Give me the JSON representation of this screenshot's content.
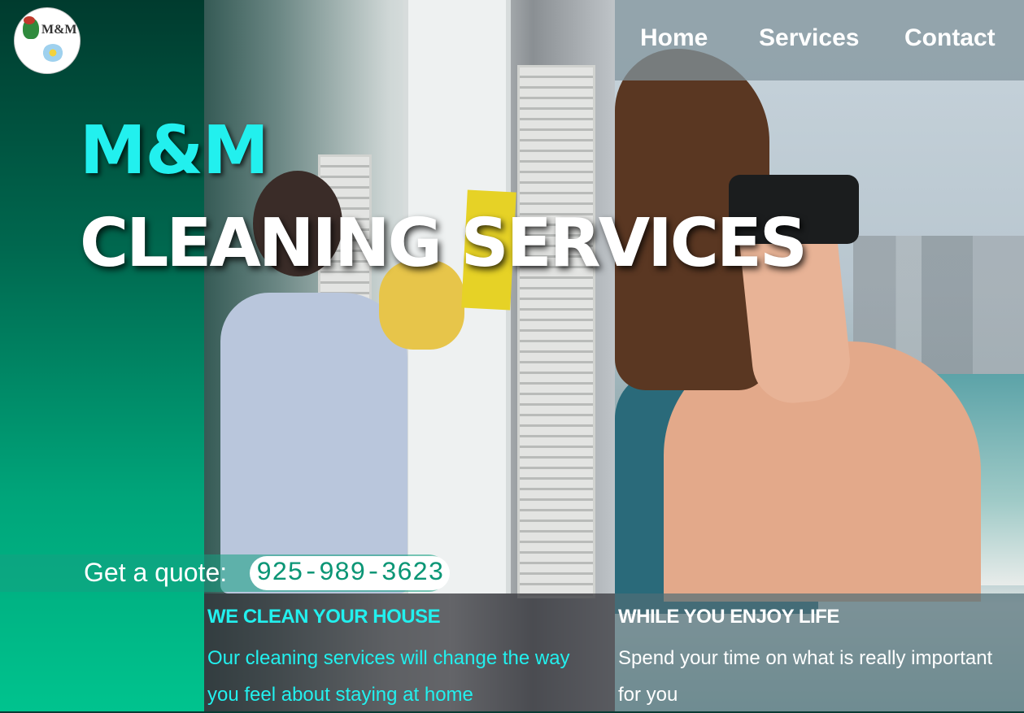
{
  "logo": {
    "text": "M&M"
  },
  "nav": {
    "items": [
      {
        "label": "Home"
      },
      {
        "label": "Services"
      },
      {
        "label": "Contact"
      }
    ]
  },
  "hero": {
    "title_line1": "M&M",
    "title_line2": "CLEANING SERVICES"
  },
  "quote": {
    "label": "Get a quote:",
    "phone": "925-989-3623"
  },
  "panels": [
    {
      "heading": "WE CLEAN YOUR HOUSE",
      "body": "Our cleaning services will change the way you feel about staying at home"
    },
    {
      "heading": "WHILE YOU ENJOY LIFE",
      "body": "Spend your time on what is really important for you"
    }
  ],
  "colors": {
    "accent_cyan": "#22f0ee",
    "accent_green": "#00c38e",
    "nav_bg": "#82949c"
  }
}
